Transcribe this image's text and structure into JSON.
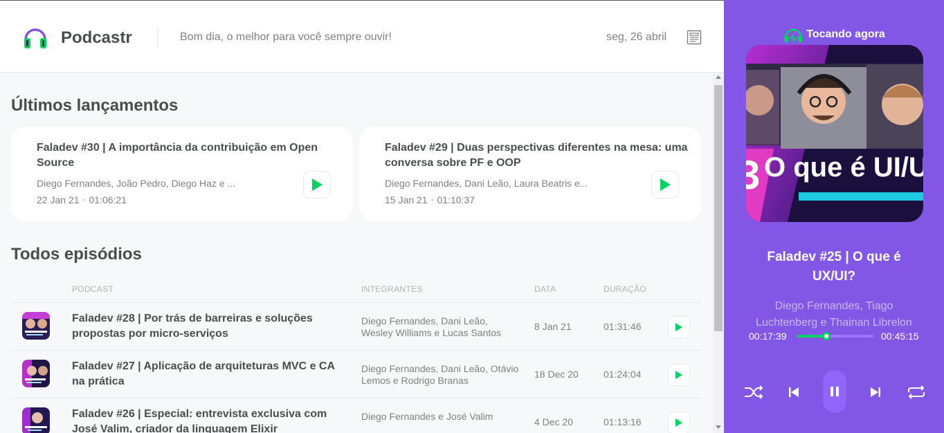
{
  "header": {
    "brand": "Podcastr",
    "greeting": "Bom dia, o melhor para você sempre ouvir!",
    "date": "seg, 26 abril",
    "logo_icon": "headphones-icon",
    "news_icon": "newspaper-icon"
  },
  "latest": {
    "title": "Últimos lançamentos",
    "cards": [
      {
        "title": "Faladev #30 | A importância da contribuição em Open Source",
        "members": "Diego Fernandes, João Pedro, Diego Haz e ...",
        "date": "22 Jan 21",
        "duration": "01:06:21"
      },
      {
        "title": "Faladev #29 | Duas perspectivas diferentes na mesa: uma conversa sobre PF e OOP",
        "members": "Diego Fernandes, Dani Leão, Laura Beatris e...",
        "date": "15 Jan 21",
        "duration": "01:10:37"
      }
    ]
  },
  "all": {
    "title": "Todos episódios",
    "columns": {
      "podcast": "PODCAST",
      "members": "INTEGRANTES",
      "date": "DATA",
      "duration": "DURAÇÃO"
    },
    "rows": [
      {
        "title": "Faladev #28 | Por trás de barreiras e soluções propostas por micro-serviços",
        "members": "Diego Fernandes, Dani Leão, Wesley Williams e Lucas Santos",
        "date": "8 Jan 21",
        "duration": "01:31:46"
      },
      {
        "title": "Faladev #27 | Aplicação de arquiteturas MVC e CA na prática",
        "members": "Diego Fernandes, Dani Leão, Otávio Lemos e Rodrigo Branas",
        "date": "18 Dec 20",
        "duration": "01:24:04"
      },
      {
        "title": "Faladev #26 | Especial: entrevista exclusiva com José Valim, criador da linguagem Elixir",
        "members": "Diego Fernandes e José Valim",
        "date": "4 Dec 20",
        "duration": "01:13:16"
      }
    ]
  },
  "player": {
    "now_playing": "Tocando agora",
    "cover_text": "O que é UI/U",
    "episode_title": "Faladev #25 | O que é UX/UI?",
    "members": "Diego Fernandes, Tiago Luchtenberg e Thainan Librelon",
    "current_time": "00:17:39",
    "total_time": "00:45:15",
    "progress": 0.39
  },
  "colors": {
    "accent": "#8257E5",
    "green": "#04D361",
    "text": "#494D4B",
    "muted": "#808080"
  }
}
